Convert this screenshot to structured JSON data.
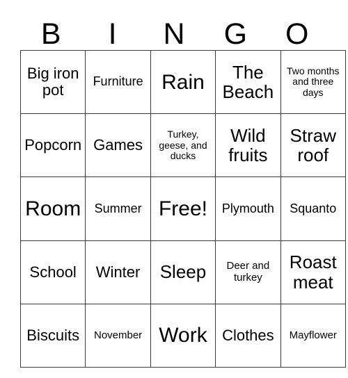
{
  "card": {
    "title": "Bingo Card",
    "header_letters": [
      "B",
      "I",
      "N",
      "G",
      "O"
    ],
    "columns": 5,
    "rows": 5,
    "free_space": {
      "row": 2,
      "col": 2,
      "label": "Free!"
    },
    "colors": {
      "background": "#ffffff",
      "text": "#000000",
      "border": "#3b3b3b"
    },
    "cells": [
      [
        {
          "text": "Big iron pot",
          "size": "md"
        },
        {
          "text": "Furniture",
          "size": "sm"
        },
        {
          "text": "Rain",
          "size": "xl"
        },
        {
          "text": "The Beach",
          "size": "lg"
        },
        {
          "text": "Two months and three days",
          "size": "xxs"
        }
      ],
      [
        {
          "text": "Popcorn",
          "size": "md"
        },
        {
          "text": "Games",
          "size": "md"
        },
        {
          "text": "Turkey, geese, and ducks",
          "size": "xxs"
        },
        {
          "text": "Wild fruits",
          "size": "lg"
        },
        {
          "text": "Straw roof",
          "size": "lg"
        }
      ],
      [
        {
          "text": "Room",
          "size": "xl"
        },
        {
          "text": "Summer",
          "size": "sm"
        },
        {
          "text": "Free!",
          "size": "xl"
        },
        {
          "text": "Plymouth",
          "size": "sm"
        },
        {
          "text": "Squanto",
          "size": "sm"
        }
      ],
      [
        {
          "text": "School",
          "size": "md"
        },
        {
          "text": "Winter",
          "size": "md"
        },
        {
          "text": "Sleep",
          "size": "lg"
        },
        {
          "text": "Deer and turkey",
          "size": "xs"
        },
        {
          "text": "Roast meat",
          "size": "lg"
        }
      ],
      [
        {
          "text": "Biscuits",
          "size": "md"
        },
        {
          "text": "November",
          "size": "xs"
        },
        {
          "text": "Work",
          "size": "xl"
        },
        {
          "text": "Clothes",
          "size": "md"
        },
        {
          "text": "Mayflower",
          "size": "xs"
        }
      ]
    ]
  }
}
